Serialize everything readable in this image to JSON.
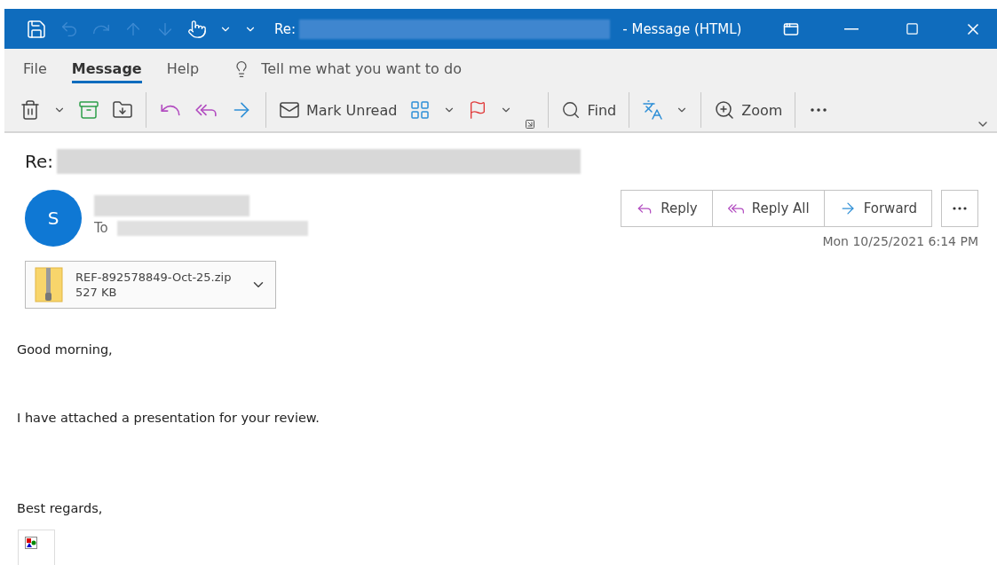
{
  "window": {
    "title_prefix": "Re:",
    "title_suffix": "- Message (HTML)"
  },
  "ribbon_tabs": [
    {
      "label": "File",
      "selected": false
    },
    {
      "label": "Message",
      "selected": true
    },
    {
      "label": "Help",
      "selected": false
    }
  ],
  "tell_me": {
    "placeholder": "Tell me what you want to do"
  },
  "toolbar": {
    "mark_unread": "Mark Unread",
    "find": "Find",
    "zoom": "Zoom"
  },
  "message": {
    "subject_prefix": "Re:",
    "avatar_initial": "S",
    "to_label": "To",
    "actions": [
      {
        "label": "Reply"
      },
      {
        "label": "Reply All"
      },
      {
        "label": "Forward"
      }
    ],
    "date": "Mon 10/25/2021 6:14 PM",
    "attachment": {
      "name": "REF-892578849-Oct-25.zip",
      "size": "527 KB"
    },
    "body": [
      "Good morning,",
      "I have attached a presentation for your review.",
      "Best regards,"
    ]
  }
}
